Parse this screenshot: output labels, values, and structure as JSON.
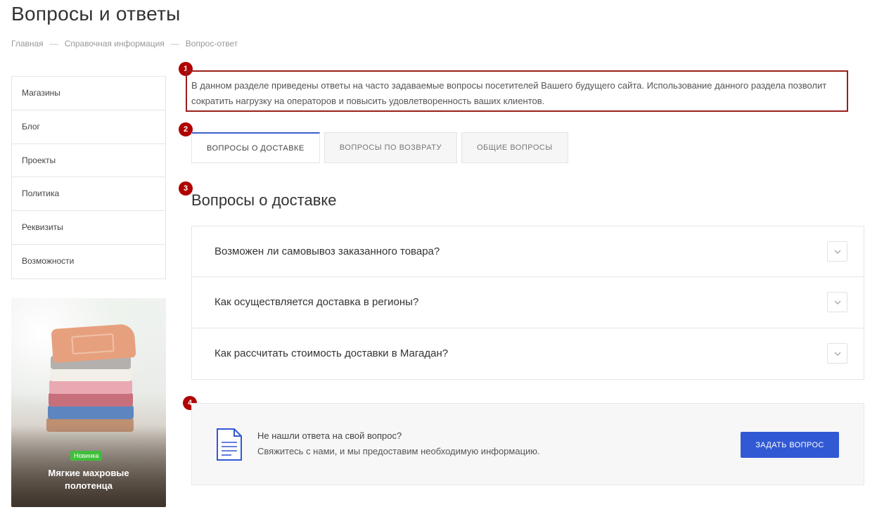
{
  "page": {
    "title": "Вопросы и ответы"
  },
  "breadcrumb": [
    "Главная",
    "Справочная информация",
    "Вопрос-ответ"
  ],
  "sidebar": {
    "items": [
      {
        "label": "Магазины"
      },
      {
        "label": "Блог"
      },
      {
        "label": "Проекты"
      },
      {
        "label": "Политика"
      },
      {
        "label": "Реквизиты"
      },
      {
        "label": "Возможности"
      }
    ]
  },
  "banner": {
    "badge": "Новинка",
    "title_line1": "Мягкие махровые",
    "title_line2": "полотенца"
  },
  "markers": [
    "1",
    "2",
    "3",
    "4"
  ],
  "intro": {
    "text": "В данном разделе приведены ответы на часто задаваемые вопросы посетителей Вашего будущего сайта. Использование данного раздела позволит сократить нагрузку на операторов и повысить удовлетворенность ваших клиентов."
  },
  "tabs": [
    {
      "label": "ВОПРОСЫ О ДОСТАВКЕ",
      "active": true
    },
    {
      "label": "ВОПРОСЫ ПО ВОЗВРАТУ",
      "active": false
    },
    {
      "label": "ОБЩИЕ ВОПРОСЫ",
      "active": false
    }
  ],
  "section": {
    "title": "Вопросы о доставке"
  },
  "faq": [
    {
      "question": "Возможен ли самовывоз заказанного товара?"
    },
    {
      "question": "Как осуществляется доставка в регионы?"
    },
    {
      "question": "Как рассчитать стоимость доставки в Магадан?"
    }
  ],
  "cta": {
    "question": "Не нашли ответа на свой вопрос?",
    "subtitle": "Свяжитесь с нами, и мы предоставим необходимую информацию.",
    "button_label": "ЗАДАТЬ ВОПРОС",
    "icon": "document-icon"
  },
  "colors": {
    "accent": "#3159d4",
    "marker": "#b00000",
    "highlight_border": "#9b1e1e",
    "badge": "#3fbf3a"
  }
}
